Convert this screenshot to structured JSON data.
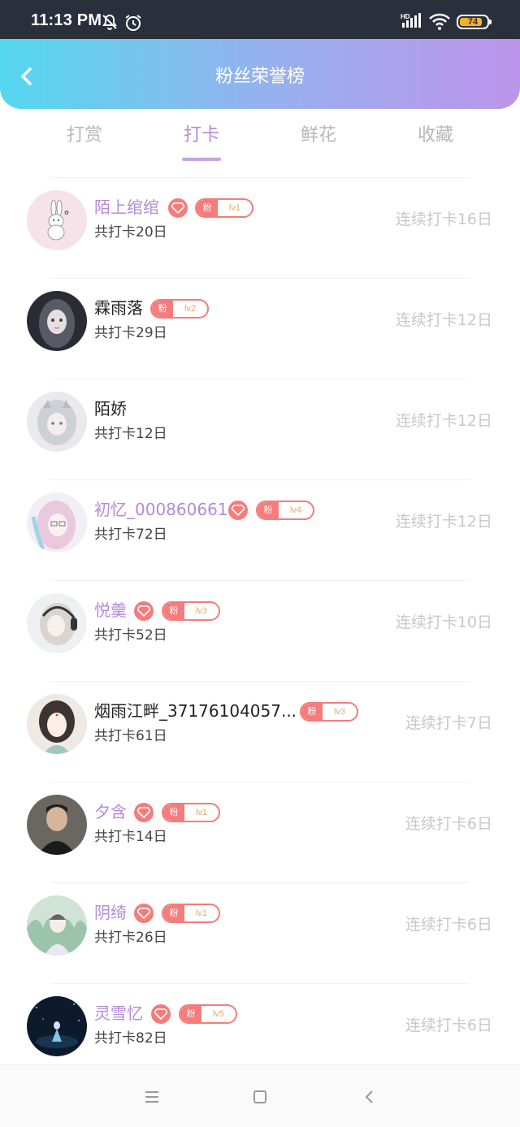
{
  "status_bar": {
    "time": "11:13 PM",
    "network": "HD",
    "battery_percent": "74"
  },
  "header": {
    "title": "粉丝荣誉榜"
  },
  "tabs": [
    {
      "label": "打赏",
      "active": false
    },
    {
      "label": "打卡",
      "active": true
    },
    {
      "label": "鲜花",
      "active": false
    },
    {
      "label": "收藏",
      "active": false
    }
  ],
  "list": [
    {
      "name": "陌上绾绾",
      "name_color": "purple",
      "gem": true,
      "fan_label": "粉",
      "level": "lv1",
      "total": "共打卡20日",
      "streak": "连续打卡16日",
      "avatar": "bunny-avatar"
    },
    {
      "name": "霖雨落",
      "name_color": "dark",
      "gem": false,
      "fan_label": "粉",
      "level": "lv2",
      "total": "共打卡29日",
      "streak": "连续打卡12日",
      "avatar": "dark-hair-avatar"
    },
    {
      "name": "陌娇",
      "name_color": "dark",
      "gem": false,
      "fan_label": "",
      "level": "",
      "total": "共打卡12日",
      "streak": "连续打卡12日",
      "avatar": "white-hair-avatar"
    },
    {
      "name": "初忆_000860661",
      "name_color": "purple",
      "gem": true,
      "fan_label": "粉",
      "level": "lv4",
      "total": "共打卡72日",
      "streak": "连续打卡12日",
      "avatar": "pink-hair-avatar"
    },
    {
      "name": "悦羹",
      "name_color": "purple",
      "gem": true,
      "fan_label": "粉",
      "level": "lv3",
      "total": "共打卡52日",
      "streak": "连续打卡10日",
      "avatar": "headphones-avatar"
    },
    {
      "name": "烟雨江畔_37176104057...",
      "name_color": "dark",
      "gem": false,
      "fan_label": "粉",
      "level": "lv3",
      "total": "共打卡61日",
      "streak": "连续打卡7日",
      "avatar": "hanfu-avatar"
    },
    {
      "name": "夕含",
      "name_color": "purple",
      "gem": true,
      "fan_label": "粉",
      "level": "lv1",
      "total": "共打卡14日",
      "streak": "连续打卡6日",
      "avatar": "boy-photo-avatar"
    },
    {
      "name": "阴绮",
      "name_color": "purple",
      "gem": true,
      "fan_label": "粉",
      "level": "lv1",
      "total": "共打卡26日",
      "streak": "连续打卡6日",
      "avatar": "forest-boy-avatar"
    },
    {
      "name": "灵雪忆",
      "name_color": "purple",
      "gem": true,
      "fan_label": "粉",
      "level": "lv5",
      "total": "共打卡82日",
      "streak": "连续打卡6日",
      "avatar": "night-sky-avatar"
    }
  ],
  "colors": {
    "accent_purple": "#b58ad8",
    "badge_red": "#f47c7c",
    "header_start": "#53d8ef",
    "header_end": "#bd94eb"
  }
}
